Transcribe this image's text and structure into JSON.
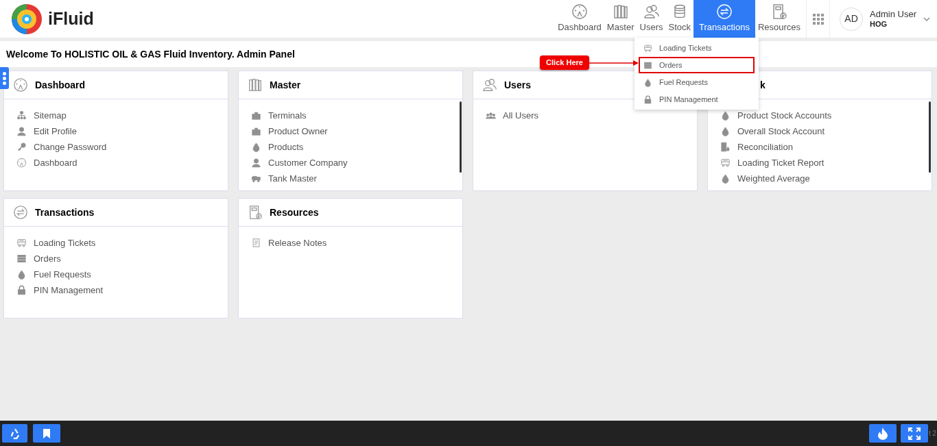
{
  "header": {
    "logo_text": "iFluid",
    "nav": [
      {
        "label": "Dashboard",
        "kind": "gauge",
        "selected": false
      },
      {
        "label": "Master",
        "kind": "books",
        "selected": false
      },
      {
        "label": "Users",
        "kind": "users",
        "selected": false
      },
      {
        "label": "Stock",
        "kind": "coins",
        "selected": false
      },
      {
        "label": "Transactions",
        "kind": "swap",
        "selected": true
      },
      {
        "label": "Resources",
        "kind": "notebook",
        "selected": false
      }
    ],
    "user": {
      "initials": "AD",
      "name": "Admin User",
      "org": "HOG"
    }
  },
  "welcome": "Welcome To HOLISTIC OIL & GAS Fluid Inventory. Admin Panel",
  "dropdown": {
    "items": [
      {
        "label": "Loading Tickets",
        "kind": "truck",
        "selected": false
      },
      {
        "label": "Orders",
        "kind": "list",
        "selected": true
      },
      {
        "label": "Fuel Requests",
        "kind": "drop",
        "selected": false
      },
      {
        "label": "PIN Management",
        "kind": "lock",
        "selected": false
      }
    ]
  },
  "callout": "Click Here",
  "cards": [
    {
      "title": "Dashboard",
      "kind": "gauge",
      "scrollbar": false,
      "items": [
        {
          "label": "Sitemap",
          "kind": "sitemap"
        },
        {
          "label": "Edit Profile",
          "kind": "person"
        },
        {
          "label": "Change Password",
          "kind": "key"
        },
        {
          "label": "Dashboard",
          "kind": "gauge"
        }
      ]
    },
    {
      "title": "Master",
      "kind": "books",
      "scrollbar": true,
      "items": [
        {
          "label": "Terminals",
          "kind": "buildings"
        },
        {
          "label": "Product Owner",
          "kind": "buildings"
        },
        {
          "label": "Products",
          "kind": "drop"
        },
        {
          "label": "Customer Company",
          "kind": "person"
        },
        {
          "label": "Tank Master",
          "kind": "tank"
        }
      ]
    },
    {
      "title": "Users",
      "kind": "users",
      "scrollbar": false,
      "items": [
        {
          "label": "All Users",
          "kind": "group"
        }
      ]
    },
    {
      "title": "k",
      "kind": "covered",
      "scrollbar": true,
      "items": [
        {
          "label": "Product Stock Accounts",
          "kind": "drop"
        },
        {
          "label": "Overall Stock Account",
          "kind": "drop"
        },
        {
          "label": "Reconciliation",
          "kind": "barrels"
        },
        {
          "label": "Loading Ticket Report",
          "kind": "truck"
        },
        {
          "label": "Weighted Average",
          "kind": "drop"
        }
      ]
    },
    {
      "title": "Transactions",
      "kind": "swap",
      "scrollbar": false,
      "items": [
        {
          "label": "Loading Tickets",
          "kind": "truck"
        },
        {
          "label": "Orders",
          "kind": "list"
        },
        {
          "label": "Fuel Requests",
          "kind": "drop"
        },
        {
          "label": "PIN Management",
          "kind": "lock"
        }
      ]
    },
    {
      "title": "Resources",
      "kind": "notebook",
      "scrollbar": false,
      "items": [
        {
          "label": "Release Notes",
          "kind": "doc"
        }
      ]
    }
  ],
  "footer": {
    "text": "t 2"
  }
}
